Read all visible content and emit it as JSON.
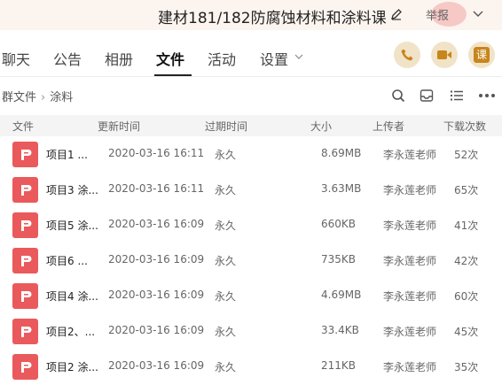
{
  "window": {
    "title": "建材181/182防腐蚀材料和涂料课",
    "report_label": "举报"
  },
  "tabs": [
    {
      "label": "聊天"
    },
    {
      "label": "公告"
    },
    {
      "label": "相册"
    },
    {
      "label": "文件"
    },
    {
      "label": "活动"
    },
    {
      "label": "设置"
    }
  ],
  "breadcrumb": {
    "root": "群文件",
    "current": "涂料"
  },
  "table": {
    "headers": [
      "文件",
      "更新时间",
      "过期时间",
      "大小",
      "上传者",
      "下载次数"
    ],
    "rows": [
      {
        "name": "项目1 ...",
        "updated": "2020-03-16 16:11",
        "expires": "永久",
        "size": "8.69MB",
        "uploader": "李永莲老师",
        "downloads": "52次"
      },
      {
        "name": "项目3 涂...",
        "updated": "2020-03-16 16:11",
        "expires": "永久",
        "size": "3.63MB",
        "uploader": "李永莲老师",
        "downloads": "65次"
      },
      {
        "name": "项目5 涂...",
        "updated": "2020-03-16 16:09",
        "expires": "永久",
        "size": "660KB",
        "uploader": "李永莲老师",
        "downloads": "41次"
      },
      {
        "name": "项目6 ...",
        "updated": "2020-03-16 16:09",
        "expires": "永久",
        "size": "735KB",
        "uploader": "李永莲老师",
        "downloads": "42次"
      },
      {
        "name": "项目4 涂...",
        "updated": "2020-03-16 16:09",
        "expires": "永久",
        "size": "4.69MB",
        "uploader": "李永莲老师",
        "downloads": "60次"
      },
      {
        "name": "项目2、...",
        "updated": "2020-03-16 16:09",
        "expires": "永久",
        "size": "33.4KB",
        "uploader": "李永莲老师",
        "downloads": "45次"
      },
      {
        "name": "项目2 涂...",
        "updated": "2020-03-16 16:09",
        "expires": "永久",
        "size": "211KB",
        "uploader": "李永莲老师",
        "downloads": "35次"
      }
    ]
  },
  "actions": {
    "course_badge": "课"
  },
  "colors": {
    "accent_tab": "#222222",
    "ppt_icon": "#ea5a5c",
    "round_button_bg": "#f1e3c7",
    "round_button_icon": "#c7851b"
  },
  "icons": [
    "edit-icon",
    "chevron-down-icon",
    "phone-icon",
    "video-icon",
    "search-icon",
    "inbox-icon",
    "list-view-icon",
    "more-icon",
    "ppt-file-icon"
  ]
}
